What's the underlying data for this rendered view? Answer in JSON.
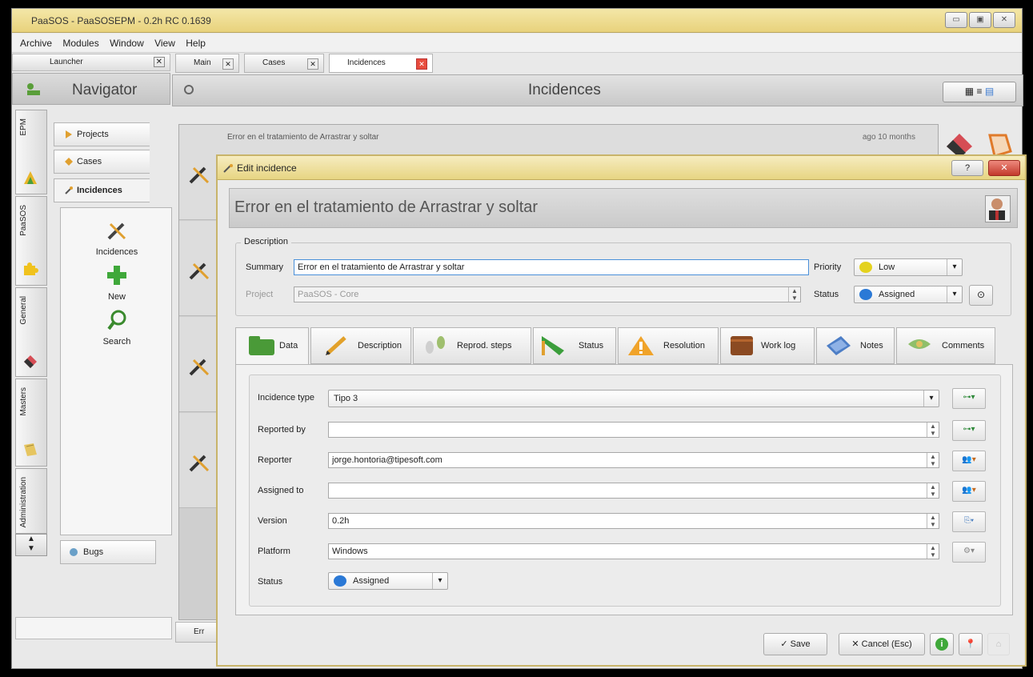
{
  "window": {
    "title": "PaaSOS - PaaSOSEPM - 0.2h RC 0.1639"
  },
  "menu": [
    "Archive",
    "Modules",
    "Window",
    "View",
    "Help"
  ],
  "launcher": {
    "label": "Launcher"
  },
  "navigator": {
    "title": "Navigator",
    "vertical_tabs": [
      "EPM",
      "PaaSOS",
      "General",
      "Masters",
      "Administration"
    ],
    "tabs": [
      "Projects",
      "Cases",
      "Incidences"
    ],
    "actions": [
      "Incidences",
      "New",
      "Search"
    ],
    "bugs": "Bugs"
  },
  "main": {
    "tabs": [
      "Main",
      "Cases",
      "Incidences"
    ],
    "header": "Incidences",
    "list_item": {
      "title": "Error en el tratamiento de Arrastrar y soltar",
      "date": "ago 10 months"
    },
    "bottom_tab": "Err"
  },
  "dialog": {
    "title": "Edit incidence",
    "heading": "Error en el tratamiento de Arrastrar y soltar",
    "description_legend": "Description",
    "summary_label": "Summary",
    "summary_value": "Error en el tratamiento de Arrastrar y soltar",
    "priority_label": "Priority",
    "priority_value": "Low",
    "project_label": "Project",
    "project_value": "PaaSOS - Core",
    "status_label": "Status",
    "status_value": "Assigned",
    "tabs": [
      "Data",
      "Description",
      "Reprod. steps",
      "Status",
      "Resolution",
      "Work log",
      "Notes",
      "Comments"
    ],
    "fields": [
      {
        "label": "Incidence type",
        "value": "Tipo 3"
      },
      {
        "label": "Reported by",
        "value": ""
      },
      {
        "label": "Reporter",
        "value": "jorge.hontoria@tipesoft.com"
      },
      {
        "label": "Assigned to",
        "value": ""
      },
      {
        "label": "Version",
        "value": "0.2h"
      },
      {
        "label": "Platform",
        "value": "Windows"
      },
      {
        "label": "Status",
        "value": "Assigned"
      }
    ],
    "save": "Save",
    "cancel": "Cancel (Esc)"
  },
  "colors": {
    "priority_low": "#e4d21e",
    "status_assigned": "#2b79d6",
    "add_green": "#3fa83a"
  }
}
